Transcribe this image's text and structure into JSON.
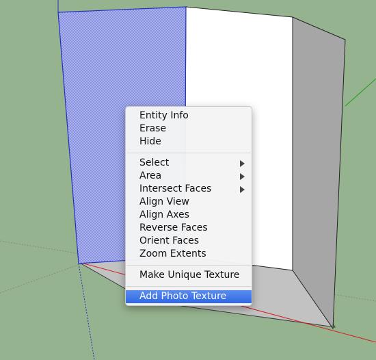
{
  "scene": {
    "background_color": "#96b38f",
    "selected_face_color": "#a9b1ef",
    "face_white": "#ffffff",
    "face_gray": "#a6a6a6",
    "face_shadow": "#c2c2c2",
    "axis_red": "#d32020",
    "axis_green": "#1aa01a",
    "axis_blue": "#2030c0"
  },
  "context_menu": {
    "group1": [
      {
        "label": "Entity Info"
      },
      {
        "label": "Erase"
      },
      {
        "label": "Hide"
      }
    ],
    "group2": [
      {
        "label": "Select",
        "submenu": true
      },
      {
        "label": "Area",
        "submenu": true
      },
      {
        "label": "Intersect Faces",
        "submenu": true
      },
      {
        "label": "Align View"
      },
      {
        "label": "Align Axes"
      },
      {
        "label": "Reverse Faces"
      },
      {
        "label": "Orient Faces"
      },
      {
        "label": "Zoom Extents"
      }
    ],
    "group3": [
      {
        "label": "Make Unique Texture"
      }
    ],
    "group4": [
      {
        "label": "Add Photo Texture",
        "highlighted": true
      }
    ]
  }
}
